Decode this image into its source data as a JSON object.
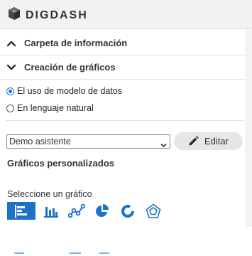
{
  "app": {
    "logo_text": "DIGDASH",
    "logo_icon": "cube-icon"
  },
  "sections": [
    {
      "label": "Carpeta de información",
      "state": "collapsed",
      "icon": "chevron-up-icon"
    },
    {
      "label": "Creación de gráficos",
      "state": "expanded",
      "icon": "chevron-down-icon"
    }
  ],
  "creation_mode": {
    "options": [
      {
        "label": "El uso de modelo de datos",
        "checked": true
      },
      {
        "label": "En lenguaje natural",
        "checked": false
      }
    ]
  },
  "assistant": {
    "selected": "Demo asistente",
    "edit_label": "Editar"
  },
  "custom_charts": {
    "heading": "Gráficos personalizados",
    "select_label": "Seleccione un gráfico",
    "types": [
      {
        "name": "horizontal-bar-chart-icon",
        "selected": true
      },
      {
        "name": "bar-chart-icon",
        "selected": false
      },
      {
        "name": "line-chart-icon",
        "selected": false
      },
      {
        "name": "pie-chart-icon",
        "selected": false
      },
      {
        "name": "donut-chart-icon",
        "selected": false
      },
      {
        "name": "radar-chart-icon",
        "selected": false
      }
    ]
  },
  "colors": {
    "accent": "#1a73c9",
    "radio_accent": "#1a73e8"
  }
}
